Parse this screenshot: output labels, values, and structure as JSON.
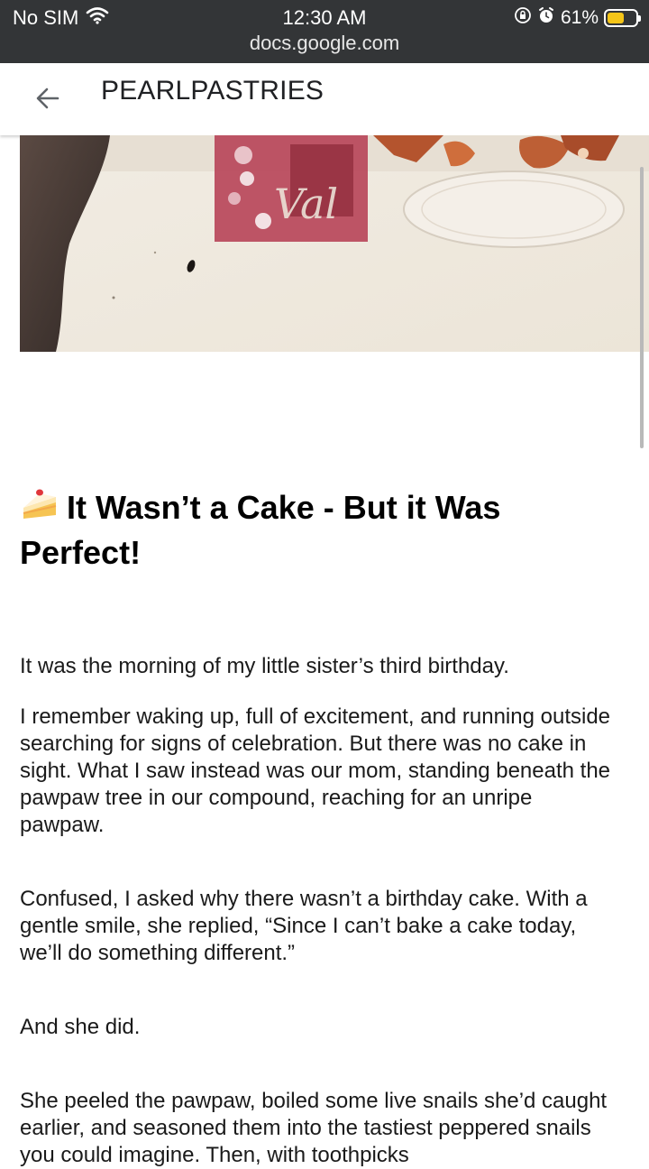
{
  "status_bar": {
    "carrier": "No SIM",
    "time": "12:30 AM",
    "url": "docs.google.com",
    "battery_percent": "61%",
    "battery_level": 0.61,
    "icons": [
      "wifi-icon",
      "rotation-lock-icon",
      "alarm-icon",
      "battery-icon"
    ]
  },
  "toolbar": {
    "back_icon": "back-arrow-icon",
    "title": "PEARLPASTRIES"
  },
  "article": {
    "heading_icon": "cake-slice-icon",
    "heading_line1": "It Wasn’t a Cake - But it Was",
    "heading_line2": "Perfect!",
    "paragraphs": [
      "It was the morning of my little sister’s third birthday.",
      "I remember waking up, full of excitement, and running outside searching for signs of celebration. But there was no cake in sight. What I saw instead was our mom, standing beneath the pawpaw tree in our compound, reaching for an unripe pawpaw.",
      "Confused, I asked why there wasn’t a birthday cake. With a gentle smile, she replied, “Since I can’t bake a cake today, we’ll do something different.”",
      "And she did.",
      "She peeled the pawpaw, boiled some live snails she’d caught earlier, and seasoned them into the tastiest peppered snails you could imagine. Then, with toothpicks"
    ]
  },
  "colors": {
    "status_bar_bg": "#333537",
    "battery_fill": "#f5c518",
    "text": "#1a1a1a"
  }
}
